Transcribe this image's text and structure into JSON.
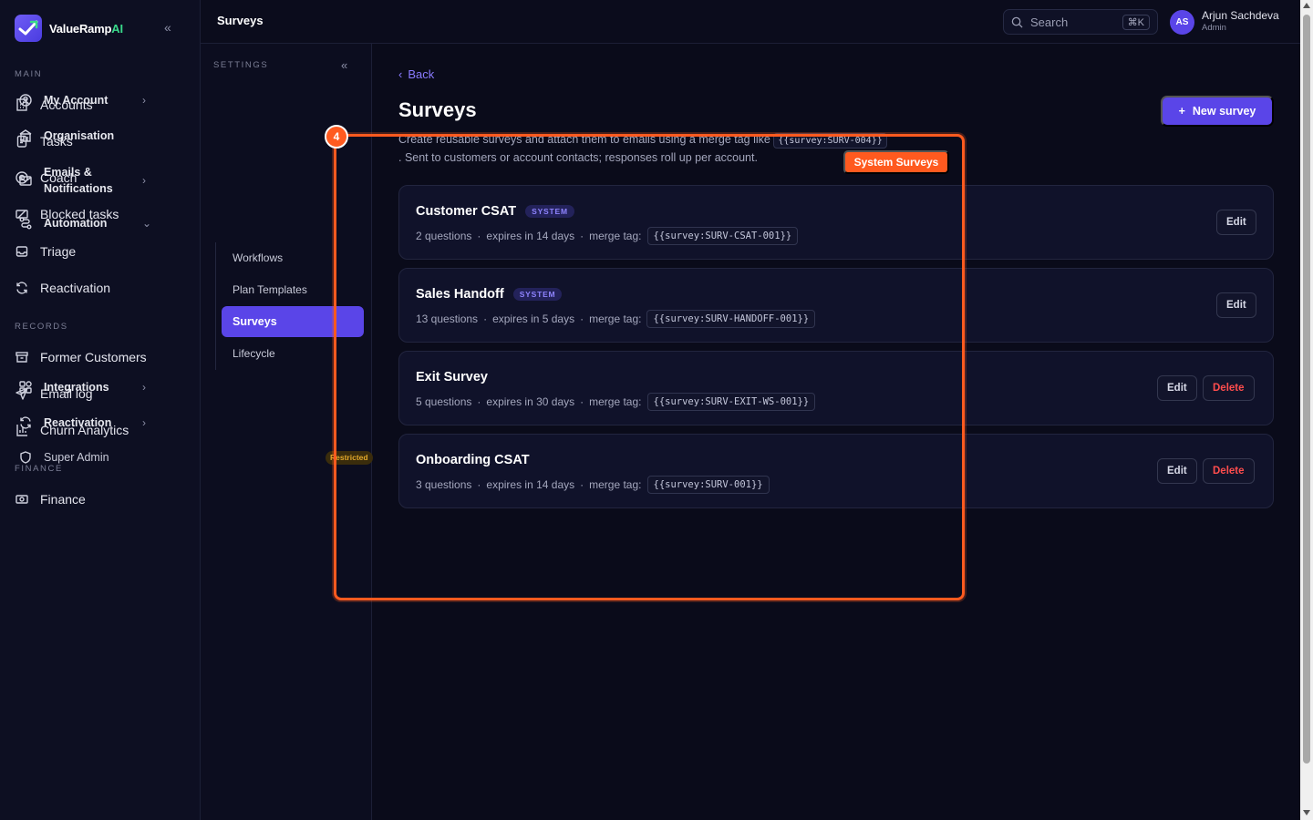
{
  "brand": {
    "name_main": "ValueRamp",
    "name_ai": "AI"
  },
  "sidebar": {
    "sections": {
      "main": "MAIN",
      "records": "RECORDS",
      "finance": "FINANCE"
    },
    "main_items": [
      {
        "label": "Accounts",
        "icon": "building-icon"
      },
      {
        "label": "Tasks",
        "icon": "clipboard-icon"
      },
      {
        "label": "Coach",
        "icon": "target-icon"
      },
      {
        "label": "Blocked tasks",
        "icon": "blocked-icon"
      },
      {
        "label": "Triage",
        "icon": "inbox-icon"
      },
      {
        "label": "Reactivation",
        "icon": "refresh-icon"
      }
    ],
    "record_items": [
      {
        "label": "Former Customers",
        "icon": "archive-icon"
      },
      {
        "label": "Email log",
        "icon": "send-icon"
      },
      {
        "label": "Churn Analytics",
        "icon": "chart-icon"
      }
    ],
    "finance_items": [
      {
        "label": "Finance",
        "icon": "money-icon"
      }
    ]
  },
  "topbar": {
    "title": "Surveys",
    "search_placeholder": "Search",
    "search_shortcut": "⌘K",
    "user": {
      "initials": "AS",
      "name": "Arjun Sachdeva",
      "role": "Admin"
    }
  },
  "settings": {
    "label": "SETTINGS",
    "items": {
      "my_account": "My Account",
      "organisation": "Organisation",
      "emails_line1": "Emails &",
      "emails_line2": "Notifications",
      "automation": "Automation",
      "integrations": "Integrations",
      "reactivation": "Reactivation",
      "super_admin": "Super Admin",
      "restricted": "Restricted"
    },
    "automation_sub": {
      "workflows": "Workflows",
      "plan_templates": "Plan Templates",
      "surveys": "Surveys",
      "lifecycle": "Lifecycle"
    }
  },
  "main": {
    "back": "Back",
    "title": "Surveys",
    "description_pre": "Create reusable surveys and attach them to emails using a merge tag like",
    "description_tag": "{{survey:SURV-004}}",
    "description_post": ". Sent to customers or account contacts; responses roll up per account.",
    "new_survey": "New survey",
    "system_surveys": "System Surveys",
    "merge_tag_label": "merge tag:",
    "edit": "Edit",
    "delete": "Delete",
    "surveys": [
      {
        "name": "Customer CSAT",
        "badge": "SYSTEM",
        "questions": "2 questions",
        "expires": "expires in 14 days",
        "tag": "{{survey:SURV-CSAT-001}}"
      },
      {
        "name": "Sales Handoff",
        "badge": "SYSTEM",
        "questions": "13 questions",
        "expires": "expires in 5 days",
        "tag": "{{survey:SURV-HANDOFF-001}}"
      },
      {
        "name": "Exit Survey",
        "badge": "",
        "questions": "5 questions",
        "expires": "expires in 30 days",
        "tag": "{{survey:SURV-EXIT-WS-001}}"
      },
      {
        "name": "Onboarding CSAT",
        "badge": "",
        "questions": "3 questions",
        "expires": "expires in 14 days",
        "tag": "{{survey:SURV-001}}"
      }
    ]
  },
  "annotation": {
    "step": "4"
  },
  "colors": {
    "accent": "#5a45e8",
    "highlight": "#ff5a1f",
    "danger": "#ff4d4d",
    "background": "#0a0b1a"
  }
}
